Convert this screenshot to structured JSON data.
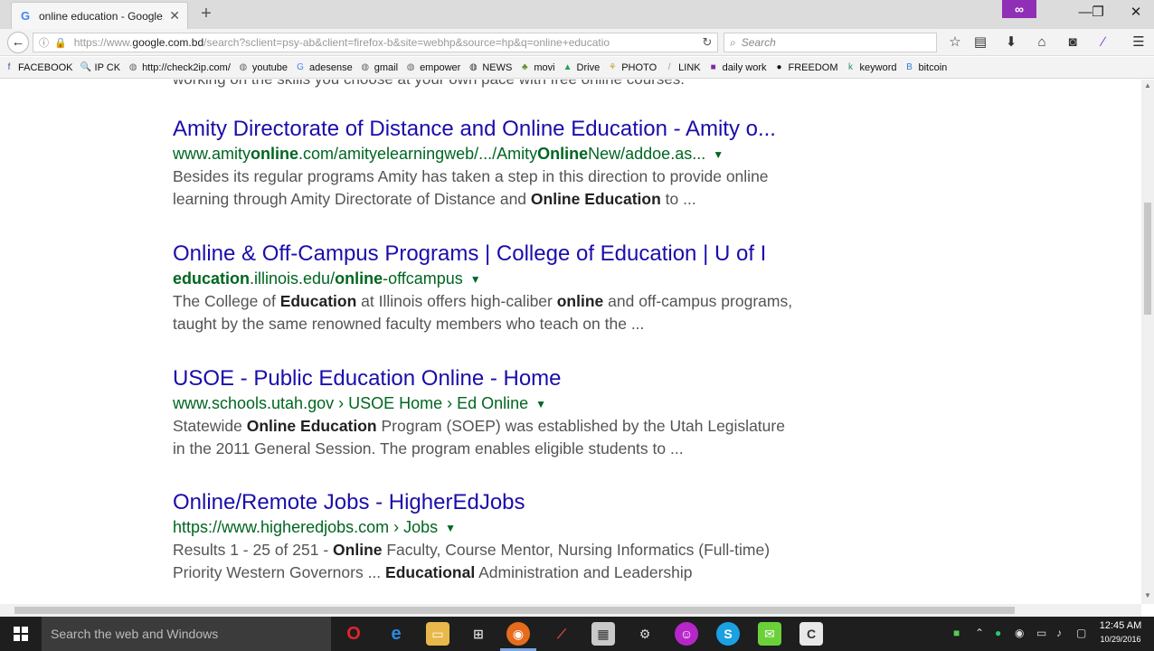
{
  "browser": {
    "tab_title": "online education - Google...",
    "tab_favicon": "G",
    "url_prefix": "https://www.",
    "url_domain": "google.com.bd",
    "url_rest": "/search?sclient=psy-ab&client=firefox-b&site=webhp&source=hp&q=online+educatio",
    "search_placeholder": "Search",
    "private_icon": "∞"
  },
  "bookmarks": [
    {
      "label": "FACEBOOK",
      "icon": "f",
      "color": "#3b5998"
    },
    {
      "label": "IP CK",
      "icon": "🔍",
      "color": "#999999"
    },
    {
      "label": "http://check2ip.com/",
      "icon": "◍",
      "color": "#666666"
    },
    {
      "label": "youtube",
      "icon": "◍",
      "color": "#666666"
    },
    {
      "label": "adesense",
      "icon": "G",
      "color": "#4285f4"
    },
    {
      "label": "gmail",
      "icon": "◍",
      "color": "#666666"
    },
    {
      "label": "empower",
      "icon": "◍",
      "color": "#666666"
    },
    {
      "label": "NEWS",
      "icon": "◍",
      "color": "#333333"
    },
    {
      "label": "movi",
      "icon": "♣",
      "color": "#5a8f29"
    },
    {
      "label": "Drive",
      "icon": "▲",
      "color": "#1fa463"
    },
    {
      "label": "PHOTO",
      "icon": "⚘",
      "color": "#c7a43a"
    },
    {
      "label": "LINK",
      "icon": "/",
      "color": "#999999"
    },
    {
      "label": "daily work",
      "icon": "■",
      "color": "#7a2d9c"
    },
    {
      "label": "FREEDOM",
      "icon": "●",
      "color": "#111111"
    },
    {
      "label": "keyword",
      "icon": "k",
      "color": "#2a8c7a"
    },
    {
      "label": "bitcoin",
      "icon": "B",
      "color": "#2d7fd3"
    }
  ],
  "page": {
    "partial_line": "working on the skills you choose at your own pace with free online courses.",
    "results": [
      {
        "title": "Amity Directorate of Distance and Online Education - Amity o...",
        "url_parts": [
          [
            "www.amity",
            false
          ],
          [
            "online",
            true
          ],
          [
            ".com/amityelearningweb/.../Amity",
            false
          ],
          [
            "Online",
            true
          ],
          [
            "New/addoe.as...",
            false
          ]
        ],
        "snippet_lines": [
          [
            [
              "Besides its regular programs Amity has taken a step in this direction to provide online",
              false
            ]
          ],
          [
            [
              "learning through Amity Directorate of Distance and ",
              false
            ],
            [
              "Online Education",
              true
            ],
            [
              " to ...",
              false
            ]
          ]
        ]
      },
      {
        "title": "Online & Off-Campus Programs | College of Education | U of I",
        "url_parts": [
          [
            "education",
            true
          ],
          [
            ".illinois.edu/",
            false
          ],
          [
            "online",
            true
          ],
          [
            "-offcampus",
            false
          ]
        ],
        "snippet_lines": [
          [
            [
              "The College of ",
              false
            ],
            [
              "Education",
              true
            ],
            [
              " at Illinois offers high-caliber ",
              false
            ],
            [
              "online",
              true
            ],
            [
              " and off-campus programs,",
              false
            ]
          ],
          [
            [
              "taught by the same renowned faculty members who teach on the ...",
              false
            ]
          ]
        ]
      },
      {
        "title": "USOE - Public Education Online - Home",
        "url_parts": [
          [
            "www.schools.utah.gov › USOE Home › Ed Online",
            false
          ]
        ],
        "snippet_lines": [
          [
            [
              "Statewide ",
              false
            ],
            [
              "Online Education",
              true
            ],
            [
              " Program (SOEP) was established by the Utah Legislature",
              false
            ]
          ],
          [
            [
              "in the 2011 General Session. The program enables eligible students to ...",
              false
            ]
          ]
        ]
      },
      {
        "title": "Online/Remote Jobs - HigherEdJobs",
        "url_parts": [
          [
            "https://www.higheredjobs.com › Jobs",
            false
          ]
        ],
        "snippet_lines": [
          [
            [
              "Results 1 - 25 of 251 - ",
              false
            ],
            [
              "Online",
              true
            ],
            [
              " Faculty, Course Mentor, Nursing Informatics (Full-time)",
              false
            ]
          ],
          [
            [
              "Priority Western Governors ... ",
              false
            ],
            [
              "Educational",
              true
            ],
            [
              " Administration and Leadership",
              false
            ]
          ]
        ]
      }
    ]
  },
  "taskbar": {
    "search_text": "Search the web and Windows",
    "time": "12:45 AM",
    "date": "10/29/2016"
  }
}
